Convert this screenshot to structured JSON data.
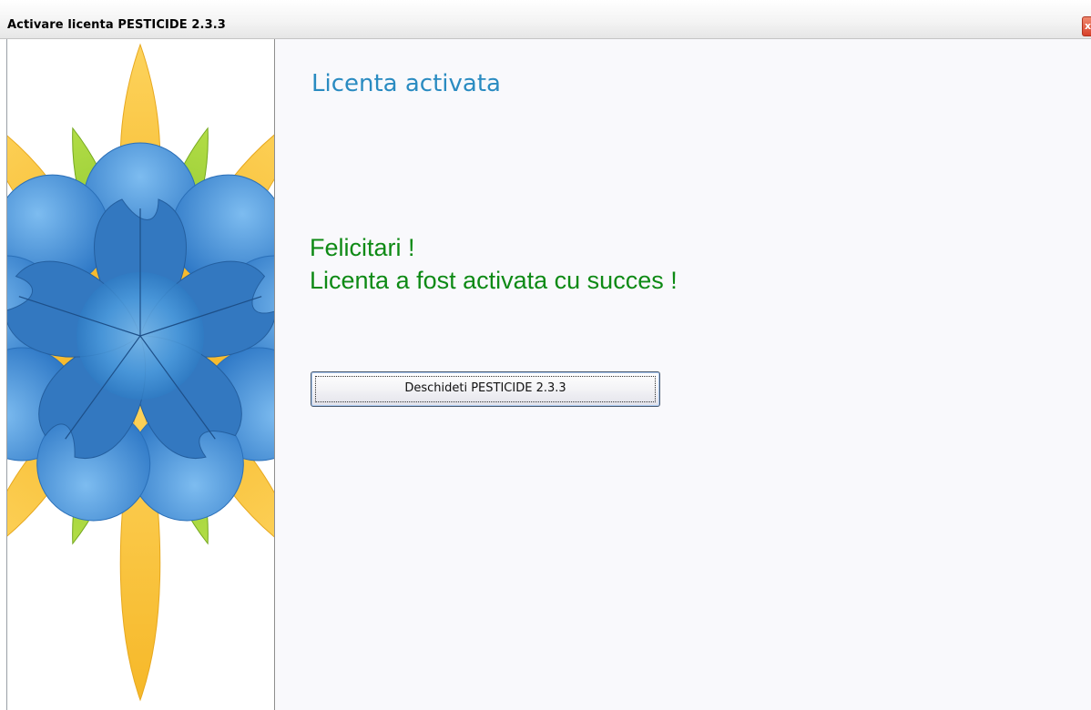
{
  "window": {
    "title": "Activare licenta PESTICIDE 2.3.3",
    "close_icon": "close-icon"
  },
  "side_panel": {
    "artwork": "flower-decoration",
    "colors": {
      "petal_yellow": "#fbc94a",
      "leaf_green": "#9ccf35",
      "petal_blue": "#3d8fd6",
      "center_blue": "#6fb4ea"
    }
  },
  "main": {
    "heading": "Licenta activata",
    "congrats_line1": "Felicitari !",
    "congrats_line2": "Licenta a fost activata cu succes !",
    "open_button_label": "Deschideti PESTICIDE 2.3.3"
  },
  "colors": {
    "heading": "#2a8bc1",
    "success_text": "#0e8a15",
    "content_bg": "#f9f9fc"
  }
}
